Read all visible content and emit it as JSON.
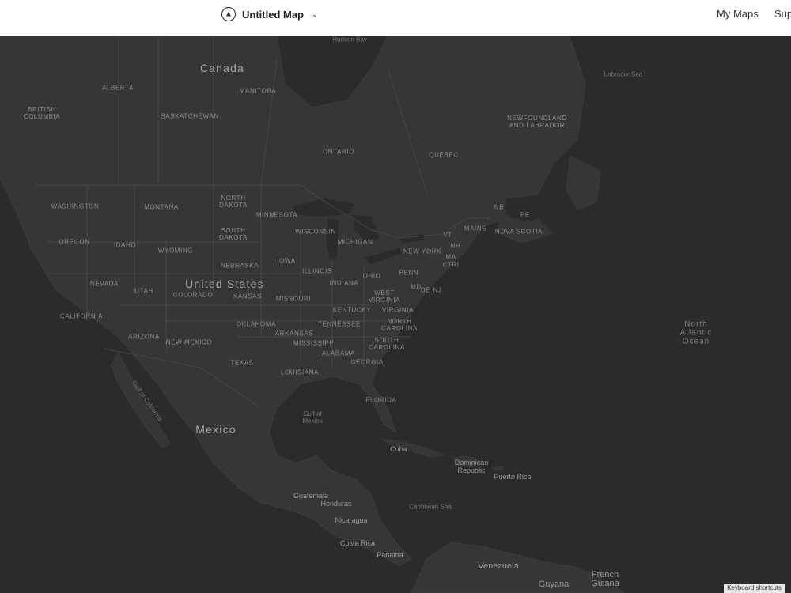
{
  "header": {
    "title": "Untitled Map",
    "nav_my_maps": "My Maps",
    "nav_support": "Sup"
  },
  "map": {
    "labels": {
      "hudson_bay": "Hudson Bay",
      "canada": "Canada",
      "alberta": "ALBERTA",
      "manitoba": "MANITOBA",
      "british_columbia": "BRITISH\nCOLUMBIA",
      "saskatchewan": "SASKATCHEWAN",
      "labrador_sea": "Labrador Sea",
      "newfoundland": "NEWFOUNDLAND\nAND LABRADOR",
      "ontario": "ONTARIO",
      "quebec": "QUEBEC",
      "north_dakota": "NORTH\nDAKOTA",
      "washington": "WASHINGTON",
      "montana": "MONTANA",
      "minnesota": "MINNESOTA",
      "nb": "NB",
      "pe": "PE",
      "south_dakota": "SOUTH\nDAKOTA",
      "wisconsin": "WISCONSIN",
      "maine": "MAINE",
      "nova_scotia": "NOVA SCOTIA",
      "vt": "VT",
      "oregon": "OREGON",
      "idaho": "IDAHO",
      "wyoming": "WYOMING",
      "michigan": "MICHIGAN",
      "nh": "NH",
      "new_york": "NEW YORK",
      "ma": "MA",
      "ct_ri": "CTRI",
      "iowa": "IOWA",
      "nebraska": "NEBRASKA",
      "illinois": "ILLINOIS",
      "ohio": "OHIO",
      "penn": "PENN",
      "united_states": "United States",
      "nevada": "NEVADA",
      "utah": "UTAH",
      "colorado": "COLORADO",
      "kansas": "KANSAS",
      "missouri": "MISSOURI",
      "indiana": "INDIANA",
      "west_virginia": "WEST\nVIRGINIA",
      "md": "MD",
      "de": "DE",
      "nj": "NJ",
      "kentucky": "KENTUCKY",
      "virginia": "VIRGINIA",
      "california": "CALIFORNIA",
      "north_atlantic": "North\nAtlantic\nOcean",
      "oklahoma": "OKLAHOMA",
      "tennessee": "TENNESSEE",
      "north_carolina": "NORTH\nCAROLINA",
      "arizona": "ARIZONA",
      "arkansas": "ARKANSAS",
      "new_mexico": "NEW MEXICO",
      "mississippi": "MISSISSIPPI",
      "south_carolina": "SOUTH\nCAROLINA",
      "alabama": "ALABAMA",
      "texas": "TEXAS",
      "georgia": "GEORGIA",
      "louisiana": "LOUISIANA",
      "gulf_of_california": "Gulf of California",
      "florida": "FLORIDA",
      "gulf_of_mexico": "Gulf of\nMexico",
      "mexico": "Mexico",
      "cuba": "Cuba",
      "dominican_republic": "Dominican\nRepublic",
      "puerto_rico": "Puerto Rico",
      "guatemala": "Guatemala",
      "honduras": "Honduras",
      "caribbean_sea": "Caribbean Sea",
      "nicaragua": "Nicaragua",
      "costa_rica": "Costa Rica",
      "panama": "Panama",
      "venezuela": "Venezuela",
      "french_guiana": "French\nGuiana",
      "guyana": "Guyana"
    },
    "keyboard_shortcuts": "Keyboard shortcuts",
    "colors": {
      "water": "#2b2b2b",
      "land": "#363636",
      "border": "#444444"
    }
  }
}
